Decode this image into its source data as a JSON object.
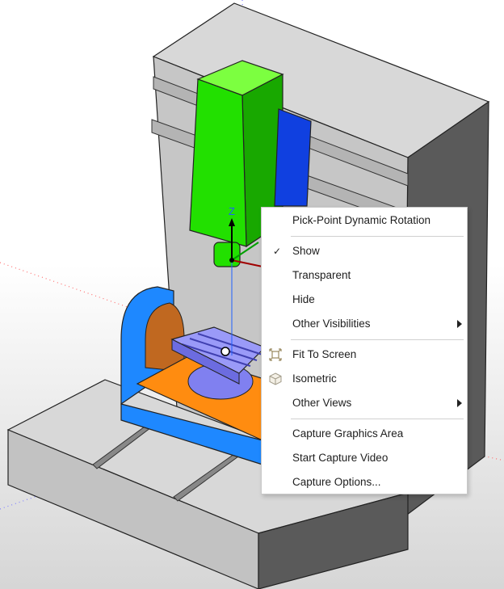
{
  "axis_label": "Z",
  "menu": {
    "pick_point": "Pick-Point Dynamic Rotation",
    "show": "Show",
    "show_check": "✓",
    "transparent": "Transparent",
    "hide": "Hide",
    "other_visibilities": "Other Visibilities",
    "fit_to_screen": "Fit To Screen",
    "isometric": "Isometric",
    "other_views": "Other Views",
    "capture_graphics": "Capture Graphics Area",
    "start_capture_video": "Start Capture Video",
    "capture_options": "Capture Options..."
  },
  "colors": {
    "spindle": "#22e000",
    "spindle_back": "#1040e0",
    "table_frame": "#1e88ff",
    "table_base": "#ff8c10",
    "rotary_disc": "#8080f0",
    "machine_body": "#d0d0d0",
    "axis_z": "#2060ff"
  }
}
